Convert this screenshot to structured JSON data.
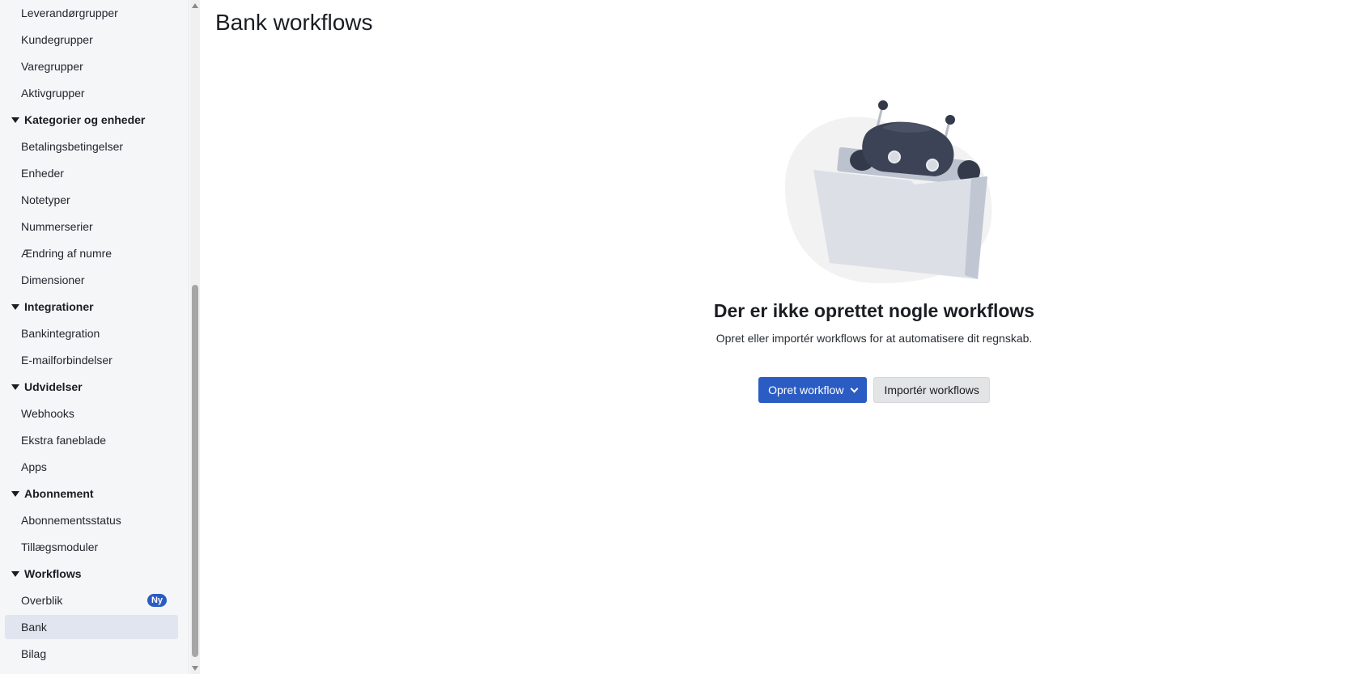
{
  "page": {
    "title": "Bank workflows"
  },
  "sidebar": {
    "items": [
      {
        "type": "item",
        "label": "Leverandørgrupper"
      },
      {
        "type": "item",
        "label": "Kundegrupper"
      },
      {
        "type": "item",
        "label": "Varegrupper"
      },
      {
        "type": "item",
        "label": "Aktivgrupper"
      },
      {
        "type": "group",
        "label": "Kategorier og enheder"
      },
      {
        "type": "item",
        "label": "Betalingsbetingelser"
      },
      {
        "type": "item",
        "label": "Enheder"
      },
      {
        "type": "item",
        "label": "Notetyper"
      },
      {
        "type": "item",
        "label": "Nummerserier"
      },
      {
        "type": "item",
        "label": "Ændring af numre"
      },
      {
        "type": "item",
        "label": "Dimensioner"
      },
      {
        "type": "group",
        "label": "Integrationer"
      },
      {
        "type": "item",
        "label": "Bankintegration"
      },
      {
        "type": "item",
        "label": "E-mailforbindelser"
      },
      {
        "type": "group",
        "label": "Udvidelser"
      },
      {
        "type": "item",
        "label": "Webhooks"
      },
      {
        "type": "item",
        "label": "Ekstra faneblade"
      },
      {
        "type": "item",
        "label": "Apps"
      },
      {
        "type": "group",
        "label": "Abonnement"
      },
      {
        "type": "item",
        "label": "Abonnementsstatus"
      },
      {
        "type": "item",
        "label": "Tillægsmoduler"
      },
      {
        "type": "group",
        "label": "Workflows"
      },
      {
        "type": "item",
        "label": "Overblik",
        "badge": "Ny"
      },
      {
        "type": "item",
        "label": "Bank",
        "active": true
      },
      {
        "type": "item",
        "label": "Bilag"
      }
    ]
  },
  "empty_state": {
    "heading": "Der er ikke oprettet nogle workflows",
    "subtext": "Opret eller importér workflows for at automatisere dit regnskab.",
    "primary_button": "Opret workflow",
    "secondary_button": "Importér workflows"
  },
  "colors": {
    "primary": "#2b5cc4",
    "sidebar_bg": "#f5f6f8",
    "active_item_bg": "#e1e5ef",
    "badge_bg": "#2b5cc4"
  },
  "icons": {
    "group_toggle": "caret-down-icon",
    "primary_button_menu": "chevron-down-icon",
    "illustration": "robot-folder-illustration"
  }
}
